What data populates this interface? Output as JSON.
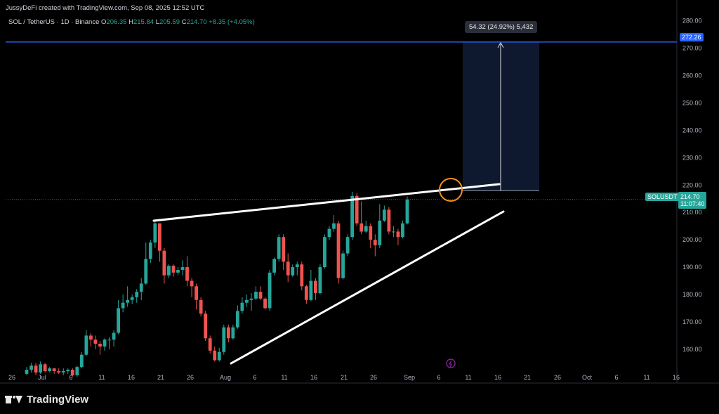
{
  "header": {
    "author_line": "JussyDeFi created with TradingView.com, Sep 08, 2025 12:52 UTC",
    "symbol_line": "SOL / TetherUS · 1D · Binance",
    "ohlc": {
      "o_label": "O",
      "o": "206.35",
      "h_label": "H",
      "h": "215.84",
      "l_label": "L",
      "l": "205.59",
      "c_label": "C",
      "c": "214.70",
      "change": "+8.35 (+4.05%)"
    }
  },
  "price_axis": {
    "ticks": [
      "280.00",
      "270.00",
      "260.00",
      "250.00",
      "240.00",
      "230.00",
      "220.00",
      "210.00",
      "200.00",
      "190.00",
      "180.00",
      "170.00",
      "160.00"
    ],
    "target_label": "272.26",
    "symbol_tag": "SOLUSDT",
    "last_price": "214.70",
    "countdown": "11:07:40"
  },
  "time_axis": {
    "ticks": [
      "26",
      "Jul",
      "6",
      "11",
      "16",
      "21",
      "26",
      "Aug",
      "6",
      "11",
      "16",
      "21",
      "26",
      "Sep",
      "6",
      "11",
      "16",
      "21",
      "26",
      "Oct",
      "6",
      "11",
      "16"
    ]
  },
  "measure": {
    "label": "54.32 (24.92%) 5,432"
  },
  "footer": {
    "brand": "TradingView"
  },
  "colors": {
    "up": "#26a69a",
    "down": "#ef5350",
    "target_line": "#2962ff",
    "highlight_circle": "#f7931a"
  },
  "chart_data": {
    "type": "candlestick",
    "title": "SOL / TetherUS · 1D · Binance",
    "ylim": [
      152,
      283
    ],
    "last_close": 214.7,
    "target_level": 272.26,
    "measure": {
      "from": 217.94,
      "to": 272.26,
      "change": 54.32,
      "change_pct": 24.92
    },
    "candles": [
      [
        151,
        152.5,
        150.5,
        153.5
      ],
      [
        152.5,
        154,
        151.5,
        155
      ],
      [
        154,
        151.5,
        150.5,
        155
      ],
      [
        151.5,
        154.5,
        151,
        155.5
      ],
      [
        154.5,
        152,
        151.5,
        155
      ],
      [
        152,
        153,
        151.5,
        153.5
      ],
      [
        153,
        152,
        151,
        153
      ],
      [
        152,
        151.5,
        151,
        153
      ],
      [
        151.5,
        152,
        150.5,
        153
      ],
      [
        152,
        152.5,
        151,
        153
      ],
      [
        152.5,
        150.5,
        150,
        153
      ],
      [
        150.5,
        153.5,
        150,
        154
      ],
      [
        153.5,
        158,
        153,
        159
      ],
      [
        158,
        165,
        157.5,
        167
      ],
      [
        165,
        163.5,
        161,
        166
      ],
      [
        163.5,
        162,
        160,
        165
      ],
      [
        162,
        161,
        158,
        163
      ],
      [
        161,
        163.5,
        159.5,
        164
      ],
      [
        163.5,
        163.5,
        160,
        164.5
      ],
      [
        163.5,
        166,
        161,
        167
      ],
      [
        166,
        175,
        165.5,
        178
      ],
      [
        175,
        177,
        173.5,
        180
      ],
      [
        177,
        178,
        175.5,
        183
      ],
      [
        178,
        179,
        176.5,
        180
      ],
      [
        179,
        181,
        177,
        182
      ],
      [
        181,
        184,
        178,
        186
      ],
      [
        184,
        193,
        183.5,
        199
      ],
      [
        193,
        199,
        191.5,
        200
      ],
      [
        199,
        206,
        197,
        207
      ],
      [
        206,
        196,
        192,
        206
      ],
      [
        196,
        187,
        184,
        197
      ],
      [
        187,
        190.5,
        186,
        191
      ],
      [
        190.5,
        188,
        186.5,
        191
      ],
      [
        188,
        189,
        187,
        190
      ],
      [
        189,
        190,
        187,
        192.5
      ],
      [
        190,
        185,
        183,
        194
      ],
      [
        185,
        183,
        179,
        186
      ],
      [
        183,
        178,
        174.5,
        184
      ],
      [
        178,
        173,
        172,
        179
      ],
      [
        173,
        164,
        163,
        174
      ],
      [
        164,
        159.5,
        158.5,
        165
      ],
      [
        159.5,
        156,
        155.5,
        161
      ],
      [
        156,
        159,
        155.5,
        160.5
      ],
      [
        159,
        168,
        158,
        169
      ],
      [
        168,
        164,
        162.5,
        169
      ],
      [
        164,
        168,
        163.5,
        169
      ],
      [
        168,
        174,
        167.5,
        176
      ],
      [
        174,
        177,
        173,
        179
      ],
      [
        177,
        178,
        175.5,
        180
      ],
      [
        178,
        178.5,
        174,
        180.5
      ],
      [
        178.5,
        181,
        178,
        183
      ],
      [
        181,
        178.5,
        178,
        183
      ],
      [
        178.5,
        175,
        174.5,
        179
      ],
      [
        175,
        188,
        174,
        189
      ],
      [
        188,
        193,
        187,
        193.5
      ],
      [
        193,
        201,
        192,
        202
      ],
      [
        201,
        192,
        189,
        202
      ],
      [
        192,
        187,
        184.5,
        195
      ],
      [
        187,
        190,
        186.5,
        191
      ],
      [
        190,
        191,
        187,
        192
      ],
      [
        191,
        183,
        181.5,
        192
      ],
      [
        183,
        178,
        176.5,
        183.5
      ],
      [
        178,
        185,
        177.5,
        189
      ],
      [
        185,
        180.5,
        178,
        186
      ],
      [
        180.5,
        190,
        180,
        191
      ],
      [
        190,
        201,
        189.5,
        202
      ],
      [
        201,
        204,
        200,
        205
      ],
      [
        204,
        206,
        203,
        209
      ],
      [
        206,
        186,
        184,
        207
      ],
      [
        186,
        195,
        185.5,
        196
      ],
      [
        195,
        201,
        194,
        202
      ],
      [
        201,
        216,
        200,
        217.5
      ],
      [
        216,
        206,
        205,
        217
      ],
      [
        206,
        203,
        202,
        214
      ],
      [
        203,
        205,
        202.5,
        207
      ],
      [
        205,
        200,
        197,
        206
      ],
      [
        200,
        198,
        194,
        202
      ],
      [
        198,
        207,
        197,
        213
      ],
      [
        207,
        211,
        206.5,
        212.5
      ],
      [
        211,
        203,
        202,
        212
      ],
      [
        203,
        203,
        201,
        205
      ],
      [
        203,
        201,
        198,
        204
      ],
      [
        201,
        206,
        200.5,
        207
      ],
      [
        206,
        214.7,
        205.6,
        215.8
      ]
    ]
  }
}
